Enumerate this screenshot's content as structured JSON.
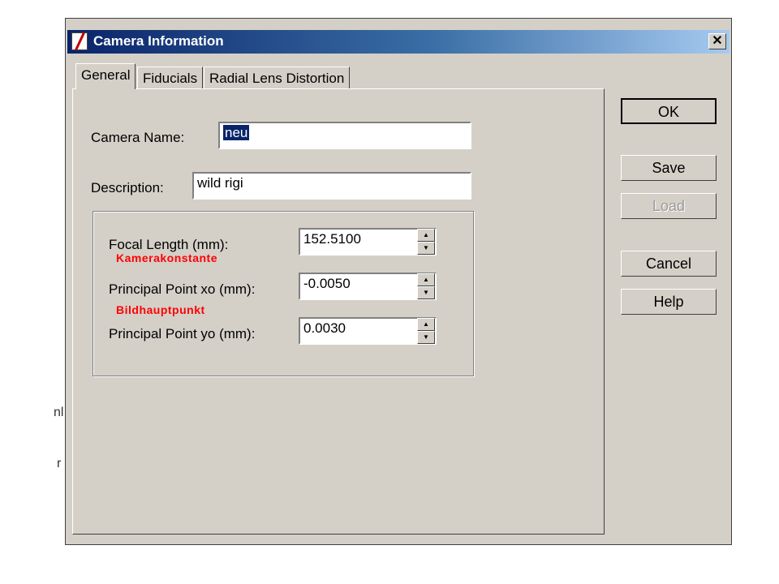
{
  "window": {
    "title": "Camera Information",
    "close_glyph": "✕"
  },
  "tabs": [
    {
      "label": "General",
      "active": true
    },
    {
      "label": "Fiducials",
      "active": false
    },
    {
      "label": "Radial Lens Distortion",
      "active": false
    }
  ],
  "fields": {
    "camera_name": {
      "label": "Camera Name:",
      "value": "neu"
    },
    "description": {
      "label": "Description:",
      "value": "wild rigi"
    },
    "focal_length": {
      "label": "Focal Length (mm):",
      "value": "152.5100"
    },
    "principal_xo": {
      "label": "Principal Point xo (mm):",
      "value": "-0.0050"
    },
    "principal_yo": {
      "label": "Principal Point yo (mm):",
      "value": "0.0030"
    }
  },
  "annotations": {
    "focal": "Kamerakonstante",
    "principal": "Bildhauptpunkt"
  },
  "buttons": {
    "ok": "OK",
    "save": "Save",
    "load": "Load",
    "cancel": "Cancel",
    "help": "Help"
  },
  "spinner_glyphs": {
    "up": "▲",
    "down": "▼"
  }
}
